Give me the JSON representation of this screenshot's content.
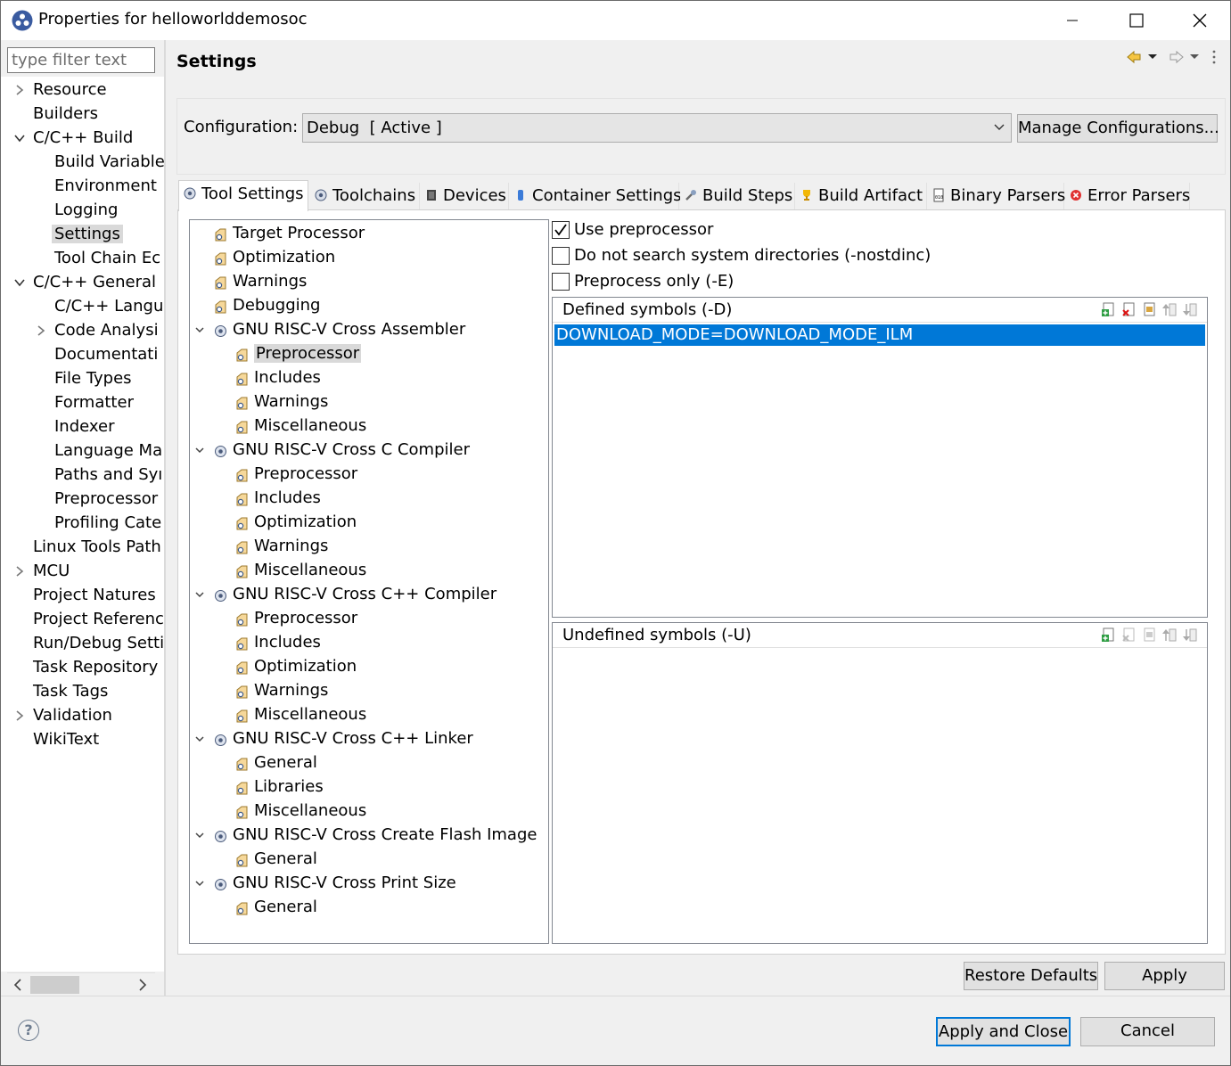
{
  "window": {
    "title": "Properties for helloworlddemosoc",
    "controls": [
      "minimize",
      "maximize",
      "close"
    ]
  },
  "sidebar": {
    "filter_placeholder": "type filter text",
    "items": [
      {
        "label": "Resource",
        "level": 0,
        "expander": "collapsed"
      },
      {
        "label": "Builders",
        "level": 0,
        "expander": "none"
      },
      {
        "label": "C/C++ Build",
        "level": 0,
        "expander": "expanded"
      },
      {
        "label": "Build Variable",
        "level": 1,
        "expander": "none"
      },
      {
        "label": "Environment",
        "level": 1,
        "expander": "none"
      },
      {
        "label": "Logging",
        "level": 1,
        "expander": "none"
      },
      {
        "label": "Settings",
        "level": 1,
        "expander": "none",
        "selected": true
      },
      {
        "label": "Tool Chain Ec",
        "level": 1,
        "expander": "none"
      },
      {
        "label": "C/C++ General",
        "level": 0,
        "expander": "expanded"
      },
      {
        "label": "C/C++ Langu",
        "level": 1,
        "expander": "none"
      },
      {
        "label": "Code Analysi",
        "level": 1,
        "expander": "collapsed"
      },
      {
        "label": "Documentati",
        "level": 1,
        "expander": "none"
      },
      {
        "label": "File Types",
        "level": 1,
        "expander": "none"
      },
      {
        "label": "Formatter",
        "level": 1,
        "expander": "none"
      },
      {
        "label": "Indexer",
        "level": 1,
        "expander": "none"
      },
      {
        "label": "Language Ma",
        "level": 1,
        "expander": "none"
      },
      {
        "label": "Paths and Syı",
        "level": 1,
        "expander": "none"
      },
      {
        "label": "Preprocessor",
        "level": 1,
        "expander": "none"
      },
      {
        "label": "Profiling Cate",
        "level": 1,
        "expander": "none"
      },
      {
        "label": "Linux Tools Path",
        "level": 0,
        "expander": "none"
      },
      {
        "label": "MCU",
        "level": 0,
        "expander": "collapsed"
      },
      {
        "label": "Project Natures",
        "level": 0,
        "expander": "none"
      },
      {
        "label": "Project Referenc",
        "level": 0,
        "expander": "none"
      },
      {
        "label": "Run/Debug Setti",
        "level": 0,
        "expander": "none"
      },
      {
        "label": "Task Repository",
        "level": 0,
        "expander": "none"
      },
      {
        "label": "Task Tags",
        "level": 0,
        "expander": "none"
      },
      {
        "label": "Validation",
        "level": 0,
        "expander": "collapsed"
      },
      {
        "label": "WikiText",
        "level": 0,
        "expander": "none"
      }
    ]
  },
  "page": {
    "title": "Settings"
  },
  "configuration": {
    "label": "Configuration:",
    "value": "Debug  [ Active ]",
    "manage_button": "Manage Configurations..."
  },
  "tabs": [
    {
      "label": "Tool Settings",
      "icon": "gear-icon",
      "active": true
    },
    {
      "label": "Toolchains",
      "icon": "gear-icon"
    },
    {
      "label": "Devices",
      "icon": "chip-icon"
    },
    {
      "label": "Container Settings",
      "icon": "container-icon"
    },
    {
      "label": "Build Steps",
      "icon": "wrench-icon"
    },
    {
      "label": "Build Artifact",
      "icon": "trophy-icon"
    },
    {
      "label": "Binary Parsers",
      "icon": "binary-file-icon"
    },
    {
      "label": "Error Parsers",
      "icon": "error-icon"
    }
  ],
  "tool_tree": [
    {
      "label": "Target Processor",
      "level": 0,
      "icon": "settings-page-icon"
    },
    {
      "label": "Optimization",
      "level": 0,
      "icon": "settings-page-icon"
    },
    {
      "label": "Warnings",
      "level": 0,
      "icon": "settings-page-icon"
    },
    {
      "label": "Debugging",
      "level": 0,
      "icon": "settings-page-icon"
    },
    {
      "label": "GNU RISC-V Cross Assembler",
      "level": 0,
      "icon": "gear-icon",
      "expander": "expanded"
    },
    {
      "label": "Preprocessor",
      "level": 1,
      "icon": "settings-page-icon",
      "selected": true
    },
    {
      "label": "Includes",
      "level": 1,
      "icon": "settings-page-icon"
    },
    {
      "label": "Warnings",
      "level": 1,
      "icon": "settings-page-icon"
    },
    {
      "label": "Miscellaneous",
      "level": 1,
      "icon": "settings-page-icon"
    },
    {
      "label": "GNU RISC-V Cross C Compiler",
      "level": 0,
      "icon": "gear-icon",
      "expander": "expanded"
    },
    {
      "label": "Preprocessor",
      "level": 1,
      "icon": "settings-page-icon"
    },
    {
      "label": "Includes",
      "level": 1,
      "icon": "settings-page-icon"
    },
    {
      "label": "Optimization",
      "level": 1,
      "icon": "settings-page-icon"
    },
    {
      "label": "Warnings",
      "level": 1,
      "icon": "settings-page-icon"
    },
    {
      "label": "Miscellaneous",
      "level": 1,
      "icon": "settings-page-icon"
    },
    {
      "label": "GNU RISC-V Cross C++ Compiler",
      "level": 0,
      "icon": "gear-icon",
      "expander": "expanded"
    },
    {
      "label": "Preprocessor",
      "level": 1,
      "icon": "settings-page-icon"
    },
    {
      "label": "Includes",
      "level": 1,
      "icon": "settings-page-icon"
    },
    {
      "label": "Optimization",
      "level": 1,
      "icon": "settings-page-icon"
    },
    {
      "label": "Warnings",
      "level": 1,
      "icon": "settings-page-icon"
    },
    {
      "label": "Miscellaneous",
      "level": 1,
      "icon": "settings-page-icon"
    },
    {
      "label": "GNU RISC-V Cross C++ Linker",
      "level": 0,
      "icon": "gear-icon",
      "expander": "expanded"
    },
    {
      "label": "General",
      "level": 1,
      "icon": "settings-page-icon"
    },
    {
      "label": "Libraries",
      "level": 1,
      "icon": "settings-page-icon"
    },
    {
      "label": "Miscellaneous",
      "level": 1,
      "icon": "settings-page-icon"
    },
    {
      "label": "GNU RISC-V Cross Create Flash Image",
      "level": 0,
      "icon": "gear-icon",
      "expander": "expanded"
    },
    {
      "label": "General",
      "level": 1,
      "icon": "settings-page-icon"
    },
    {
      "label": "GNU RISC-V Cross Print Size",
      "level": 0,
      "icon": "gear-icon",
      "expander": "expanded"
    },
    {
      "label": "General",
      "level": 1,
      "icon": "settings-page-icon"
    }
  ],
  "options": {
    "use_preprocessor": {
      "label": "Use preprocessor",
      "checked": true
    },
    "nostdinc": {
      "label": "Do not search system directories (-nostdinc)",
      "checked": false
    },
    "preprocess_only": {
      "label": "Preprocess only (-E)",
      "checked": false
    }
  },
  "defined_symbols": {
    "title": "Defined symbols (-D)",
    "values": [
      "DOWNLOAD_MODE=DOWNLOAD_MODE_ILM"
    ],
    "selected_index": 0
  },
  "undefined_symbols": {
    "title": "Undefined symbols (-U)",
    "values": []
  },
  "buttons": {
    "restore_defaults": "Restore Defaults",
    "apply": "Apply",
    "apply_and_close": "Apply and Close",
    "cancel": "Cancel",
    "help": "?"
  },
  "colors": {
    "selection": "#0078d7",
    "tree_selection": "#d9d9d9",
    "background": "#f0f0f0"
  }
}
